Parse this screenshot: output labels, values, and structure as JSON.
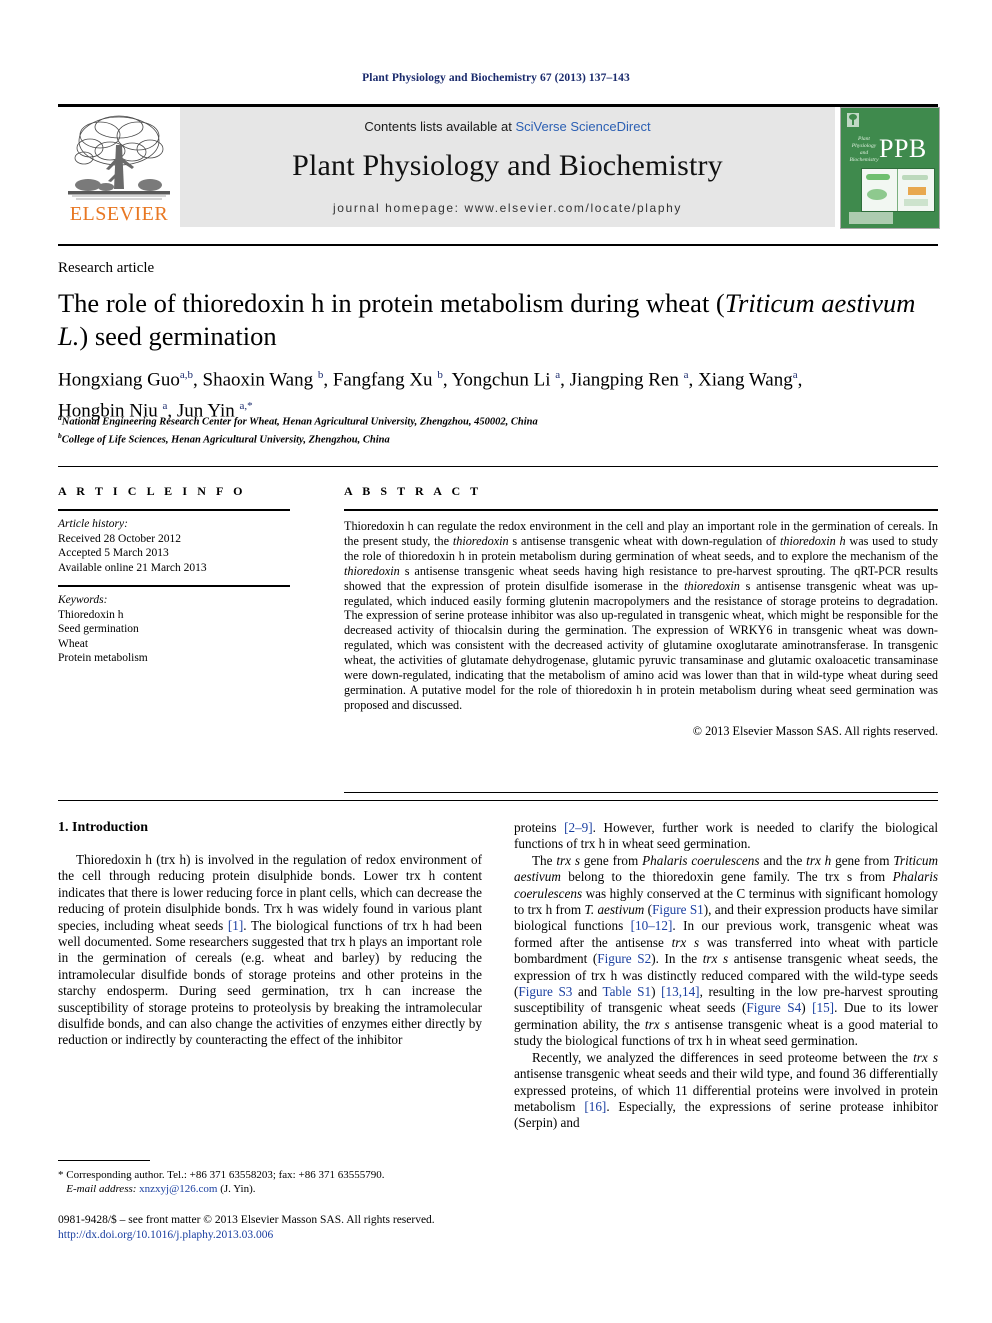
{
  "running_head": "Plant Physiology and Biochemistry 67 (2013) 137–143",
  "banner": {
    "publisher_name": "ELSEVIER",
    "contents_prefix": "Contents lists available at ",
    "contents_link": "SciVerse ScienceDirect",
    "journal_title": "Plant Physiology and Biochemistry",
    "homepage": "journal homepage: www.elsevier.com/locate/plaphy",
    "cover": {
      "journal_name_small": "Plant Physiology and Biochemistry",
      "abbrev": "PPB"
    }
  },
  "article": {
    "type_label": "Research article",
    "title_part1": "The role of thioredoxin h in protein metabolism during wheat (",
    "title_italic1": "Triticum aestivum L.",
    "title_part2": ") seed germination",
    "authors_line1": "Hongxiang Guo",
    "authors_full": "Hongxiang Guo a,b, Shaoxin Wang b, Fangfang Xu b, Yongchun Li a, Jiangping Ren a, Xiang Wang a, Hongbin Niu a, Jun Yin a,*",
    "affiliation_a": "National Engineering Research Center for Wheat, Henan Agricultural University, Zhengzhou, 450002, China",
    "affiliation_b": "College of Life Sciences, Henan Agricultural University, Zhengzhou, China"
  },
  "article_info": {
    "heading": "A R T I C L E   I N F O",
    "history_label": "Article history:",
    "history": [
      "Received 28 October 2012",
      "Accepted 5 March 2013",
      "Available online 21 March 2013"
    ],
    "keywords_label": "Keywords:",
    "keywords": [
      "Thioredoxin h",
      "Seed germination",
      "Wheat",
      "Protein metabolism"
    ]
  },
  "abstract": {
    "heading": "A B S T R A C T",
    "copyright": "© 2013 Elsevier Masson SAS. All rights reserved."
  },
  "introduction": {
    "heading": "1. Introduction",
    "left_p1_a": "Thioredoxin h (trx h) is involved in the regulation of redox environment of the cell through reducing protein disulphide bonds. Lower trx h content indicates that there is lower reducing force in plant cells, which can decrease the reducing of protein disulphide bonds. Trx h was widely found in various plant species, including wheat seeds ",
    "left_p1_ref1": "[1]",
    "left_p1_b": ". The biological functions of trx h had been well documented. Some researchers suggested that trx h plays an important role in the germination of cereals (e.g. wheat and barley) by reducing the intramolecular disulfide bonds of storage proteins and other proteins in the starchy endosperm. During seed germination, trx h can increase the susceptibility of storage proteins to proteolysis by breaking the intramolecular disulfide bonds, and can also change the activities of enzymes either directly by reduction or indirectly by counteracting the effect of the inhibitor",
    "right_p1_a": "proteins ",
    "right_p1_ref": "[2–9]",
    "right_p1_b": ". However, further work is needed to clarify the biological functions of trx h in wheat seed germination."
  },
  "footnote": {
    "corresponding": "* Corresponding author. Tel.: +86 371 63558203; fax: +86 371 63555790.",
    "email_label": "E-mail address:",
    "email": "xnzxyj@126.com",
    "email_suffix": " (J. Yin)."
  },
  "copyright_block": {
    "issn_line": "0981-9428/$ – see front matter © 2013 Elsevier Masson SAS. All rights reserved.",
    "doi": "http://dx.doi.org/10.1016/j.plaphy.2013.03.006"
  },
  "colors": {
    "link_blue": "#1a3fa0",
    "sciencedirect_blue": "#2b5fb3",
    "elsevier_orange": "#e87722",
    "cover_green": "#3f8a4d",
    "banner_gray": "#e6e6e6"
  }
}
